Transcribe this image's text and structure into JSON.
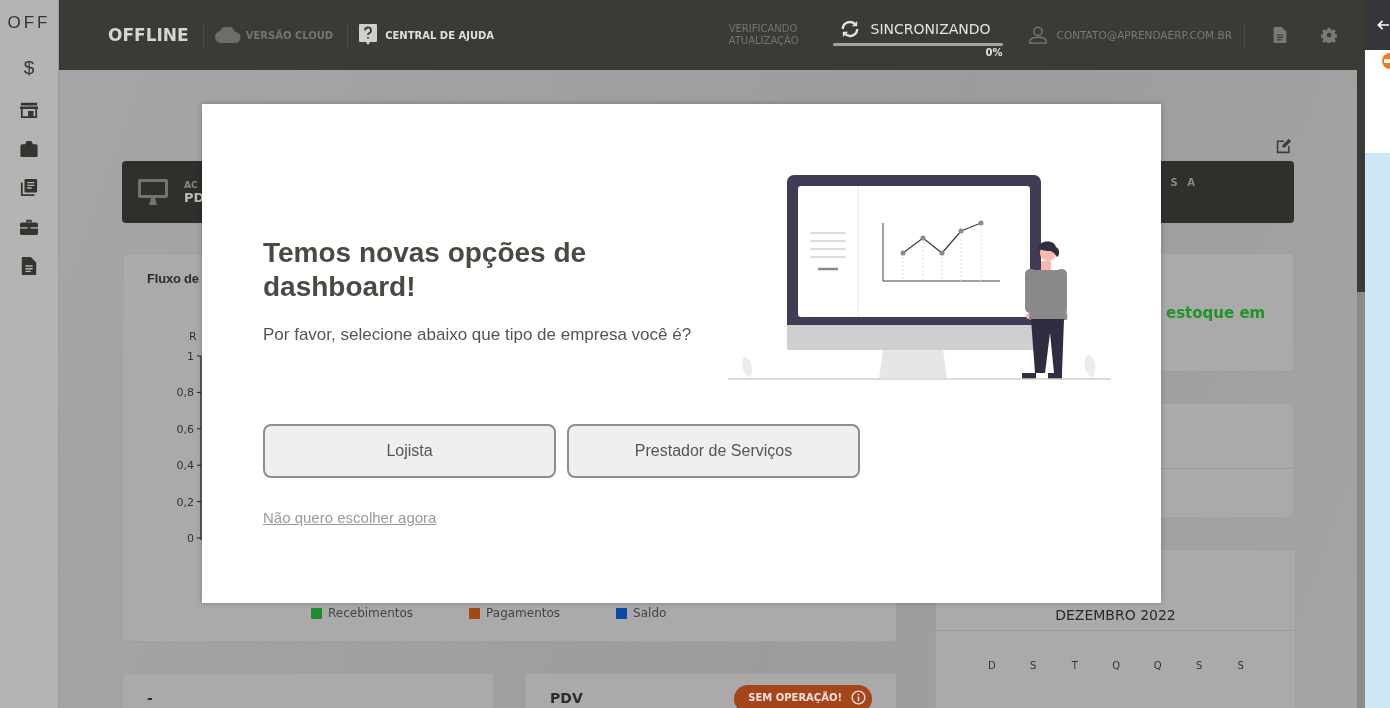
{
  "sidebar": {
    "logo": "OFF",
    "currency": "$"
  },
  "header": {
    "mode": "OFFLINE",
    "cloud": "VERSÃO CLOUD",
    "help": "CENTRAL DE AJUDA",
    "update_status": "VERIFICANDO ATUALIZAÇÃO",
    "sync": {
      "label": "SINCRONIZANDO",
      "level": 0,
      "reading": "0%"
    },
    "user": "CONTATO@APRENDAERP.COM.BR"
  },
  "dashboard": {
    "banner": {
      "left_label": "AC",
      "left_value": "PD",
      "right_label": "S A"
    },
    "cash_flow": {
      "title": "Fluxo de",
      "axis_unit": "R",
      "y_axis_labels": [
        "1",
        "0,8",
        "0,6",
        "0,4",
        "0,2",
        "0"
      ],
      "legend": [
        {
          "label": "Recebimentos",
          "color": "#1f8b2c"
        },
        {
          "label": "Pagamentos",
          "color": "#a5461a"
        },
        {
          "label": "Saldo",
          "color": "#0b4ba5"
        }
      ]
    },
    "stock": {
      "text": "estoque em"
    },
    "calendar": {
      "month": "DEZEMBRO 2022",
      "weekdays": [
        "D",
        "S",
        "T",
        "Q",
        "Q",
        "S",
        "S"
      ]
    },
    "bottom_cards": [
      {
        "title": "-"
      },
      {
        "title": "PDV",
        "badge": "SEM OPERAÇÃO!"
      }
    ]
  },
  "modal": {
    "title": "Temos novas opções de dashboard!",
    "text": "Por favor, selecione abaixo que tipo de empresa você é?",
    "options": [
      "Lojista",
      "Prestador de Serviços"
    ],
    "skip": "Não quero escolher agora"
  }
}
